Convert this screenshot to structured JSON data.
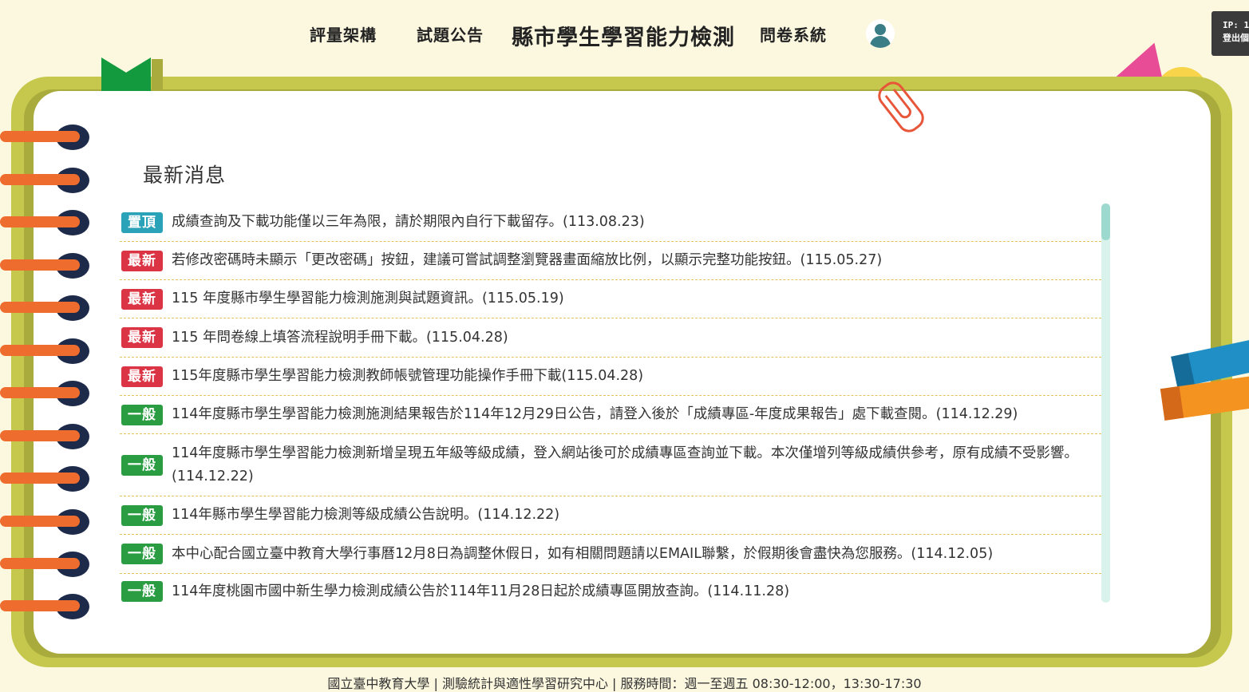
{
  "nav": {
    "item1": "評量架構",
    "item2": "試題公告",
    "title": "縣市學生學習能力檢測",
    "item4": "問卷系統"
  },
  "ip_panel": {
    "line1": "IP: 1",
    "line2": "登出個"
  },
  "section": {
    "title": "最新消息"
  },
  "news": [
    {
      "badge": "置頂",
      "type": "top",
      "text": "成績查詢及下載功能僅以三年為限，請於期限內自行下載留存。(113.08.23)"
    },
    {
      "badge": "最新",
      "type": "new",
      "text": "若修改密碼時未顯示「更改密碼」按鈕，建議可嘗試調整瀏覽器畫面縮放比例，以顯示完整功能按鈕。(115.05.27)"
    },
    {
      "badge": "最新",
      "type": "new",
      "text": "115 年度縣市學生學習能力檢測施測與試題資訊。(115.05.19)"
    },
    {
      "badge": "最新",
      "type": "new",
      "text": "115 年問卷線上填答流程說明手冊下載。(115.04.28)"
    },
    {
      "badge": "最新",
      "type": "new",
      "text": "115年度縣市學生學習能力檢測教師帳號管理功能操作手冊下載(115.04.28)"
    },
    {
      "badge": "一般",
      "type": "gen",
      "text": "114年度縣市學生學習能力檢測施測結果報告於114年12月29日公告，請登入後於「成績專區-年度成果報告」處下載查閱。(114.12.29)"
    },
    {
      "badge": "一般",
      "type": "gen",
      "text": "114年度縣市學生學習能力檢測新增呈現五年級等級成績，登入網站後可於成績專區查詢並下載。本次僅增列等級成績供參考，原有成績不受影響。(114.12.22)"
    },
    {
      "badge": "一般",
      "type": "gen",
      "text": "114年縣市學生學習能力檢測等級成績公告說明。(114.12.22)"
    },
    {
      "badge": "一般",
      "type": "gen",
      "text": "本中心配合國立臺中教育大學行事曆12月8日為調整休假日，如有相關問題請以EMAIL聯繫，於假期後會盡快為您服務。(114.12.05)"
    },
    {
      "badge": "一般",
      "type": "gen",
      "text": "114年度桃園市國中新生學力檢測成績公告於114年11月28日起於成績專區開放查詢。(114.11.28)"
    }
  ],
  "footer": "國立臺中教育大學 | 測驗統計與適性學習研究中心 | 服務時間：週一至週五 08:30-12:00，13:30-17:30"
}
